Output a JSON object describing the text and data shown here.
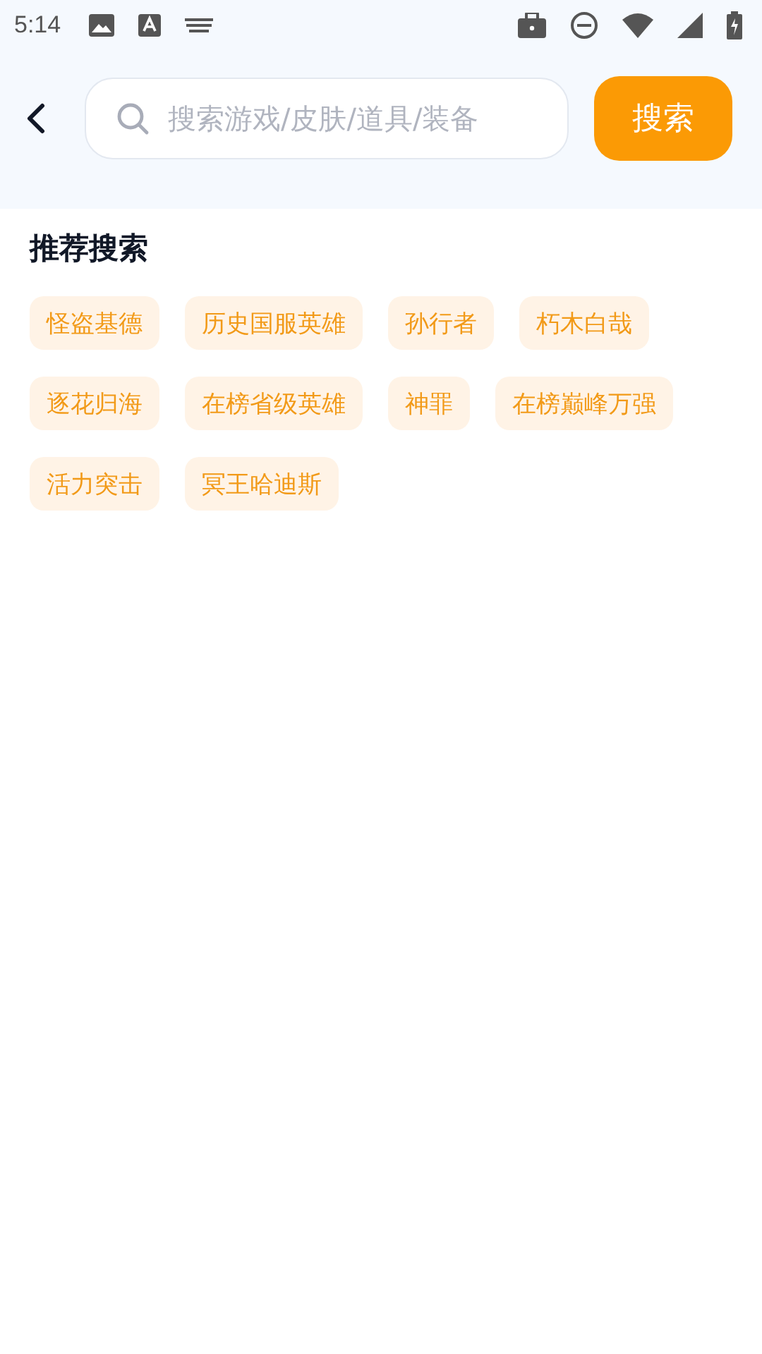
{
  "status_bar": {
    "time": "5:14"
  },
  "search": {
    "placeholder": "搜索游戏/皮肤/道具/装备",
    "button": "搜索"
  },
  "recommended": {
    "title": "推荐搜索",
    "tags": [
      "怪盗基德",
      "历史国服英雄",
      "孙行者",
      "朽木白哉",
      "逐花归海",
      "在榜省级英雄",
      "神罪",
      "在榜巅峰万强",
      "活力突击",
      "冥王哈迪斯"
    ]
  }
}
